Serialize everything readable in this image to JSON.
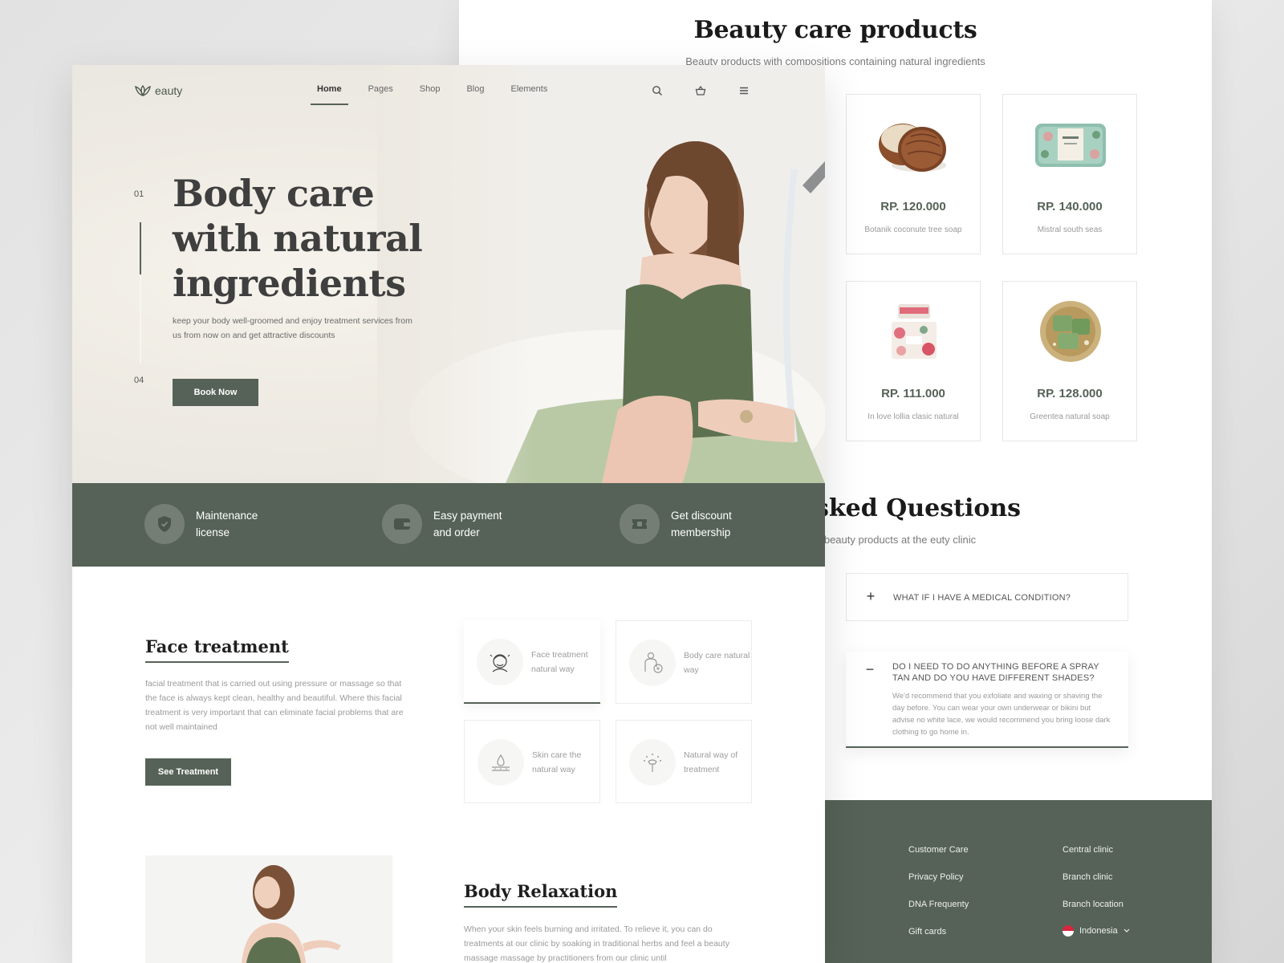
{
  "products": {
    "title": "Beauty care products",
    "subtitle": "Beauty products with compositions containing natural ingredients",
    "items": [
      {
        "price": "RP. 120.000",
        "name": "Botanik coconute tree soap",
        "icon": "coconut-soap-image"
      },
      {
        "price": "RP. 140.000",
        "name": "Mistral south seas",
        "icon": "boxed-soap-image"
      },
      {
        "price": "RP. 111.000",
        "name": "In love lollia clasic natural",
        "icon": "cream-jar-image"
      },
      {
        "price": "RP. 128.000",
        "name": "Greentea natural soap",
        "icon": "greentea-soap-image"
      }
    ]
  },
  "faq": {
    "title": "sked Questions",
    "subtitle": "d beauty products at the euty clinic",
    "items": [
      {
        "toggle": "+",
        "question": "WHAT IF I HAVE A MEDICAL CONDITION?",
        "answer": ""
      },
      {
        "toggle": "−",
        "question": "DO I NEED TO DO ANYTHING BEFORE A SPRAY TAN AND DO YOU HAVE DIFFERENT SHADES?",
        "answer": "We'd recommend that you exfoliate and waxing or shaving the day before. You can wear your own underwear or bikini but advise no white lace, we would recommend you bring loose dark clothing to go home in."
      }
    ]
  },
  "footer": {
    "col1": [
      "Customer Care",
      "Privacy Policy",
      "DNA Frequenty",
      "Gift cards"
    ],
    "col2": [
      "Central clinic",
      "Branch clinic",
      "Branch location"
    ],
    "language": "Indonesia"
  },
  "brand": {
    "logo_text": "eauty",
    "accent": "#566257"
  },
  "nav": {
    "items": [
      "Home",
      "Pages",
      "Shop",
      "Blog",
      "Elements"
    ],
    "active": "Home",
    "icons": [
      "search-icon",
      "basket-icon",
      "menu-icon"
    ]
  },
  "hero": {
    "slide_start": "01",
    "slide_end": "04",
    "slide_progress": 0.37,
    "title": "Body care with natural ingredients",
    "description": "keep your body well-groomed and enjoy treatment services from us from now on and get attractive discounts",
    "cta": "Book Now"
  },
  "features": [
    {
      "label": "Maintenance license",
      "icon": "shield-icon"
    },
    {
      "label": "Easy payment and order",
      "icon": "wallet-icon"
    },
    {
      "label": "Get discount membership",
      "icon": "ticket-icon"
    }
  ],
  "face_treatment": {
    "title": "Face treatment",
    "description": "facial treatment that is carried out using pressure or massage so that the face is always kept clean, healthy and beautiful. Where this facial treatment is very important that can eliminate facial problems that are not well maintained",
    "cta": "See Treatment",
    "cards": [
      {
        "label": "Face treatment natural way",
        "icon": "face-icon"
      },
      {
        "label": "Body care natural way",
        "icon": "body-care-icon"
      },
      {
        "label": "Skin care the natural way",
        "icon": "skin-drop-icon"
      },
      {
        "label": "Natural way of treatment",
        "icon": "spray-icon"
      }
    ]
  },
  "body_relaxation": {
    "title": "Body Relaxation",
    "description": "When your skin feels burning and irritated. To relieve it, you can do treatments at our clinic by soaking in traditional herbs and feel a beauty massage massage by practitioners from our clinic until"
  }
}
